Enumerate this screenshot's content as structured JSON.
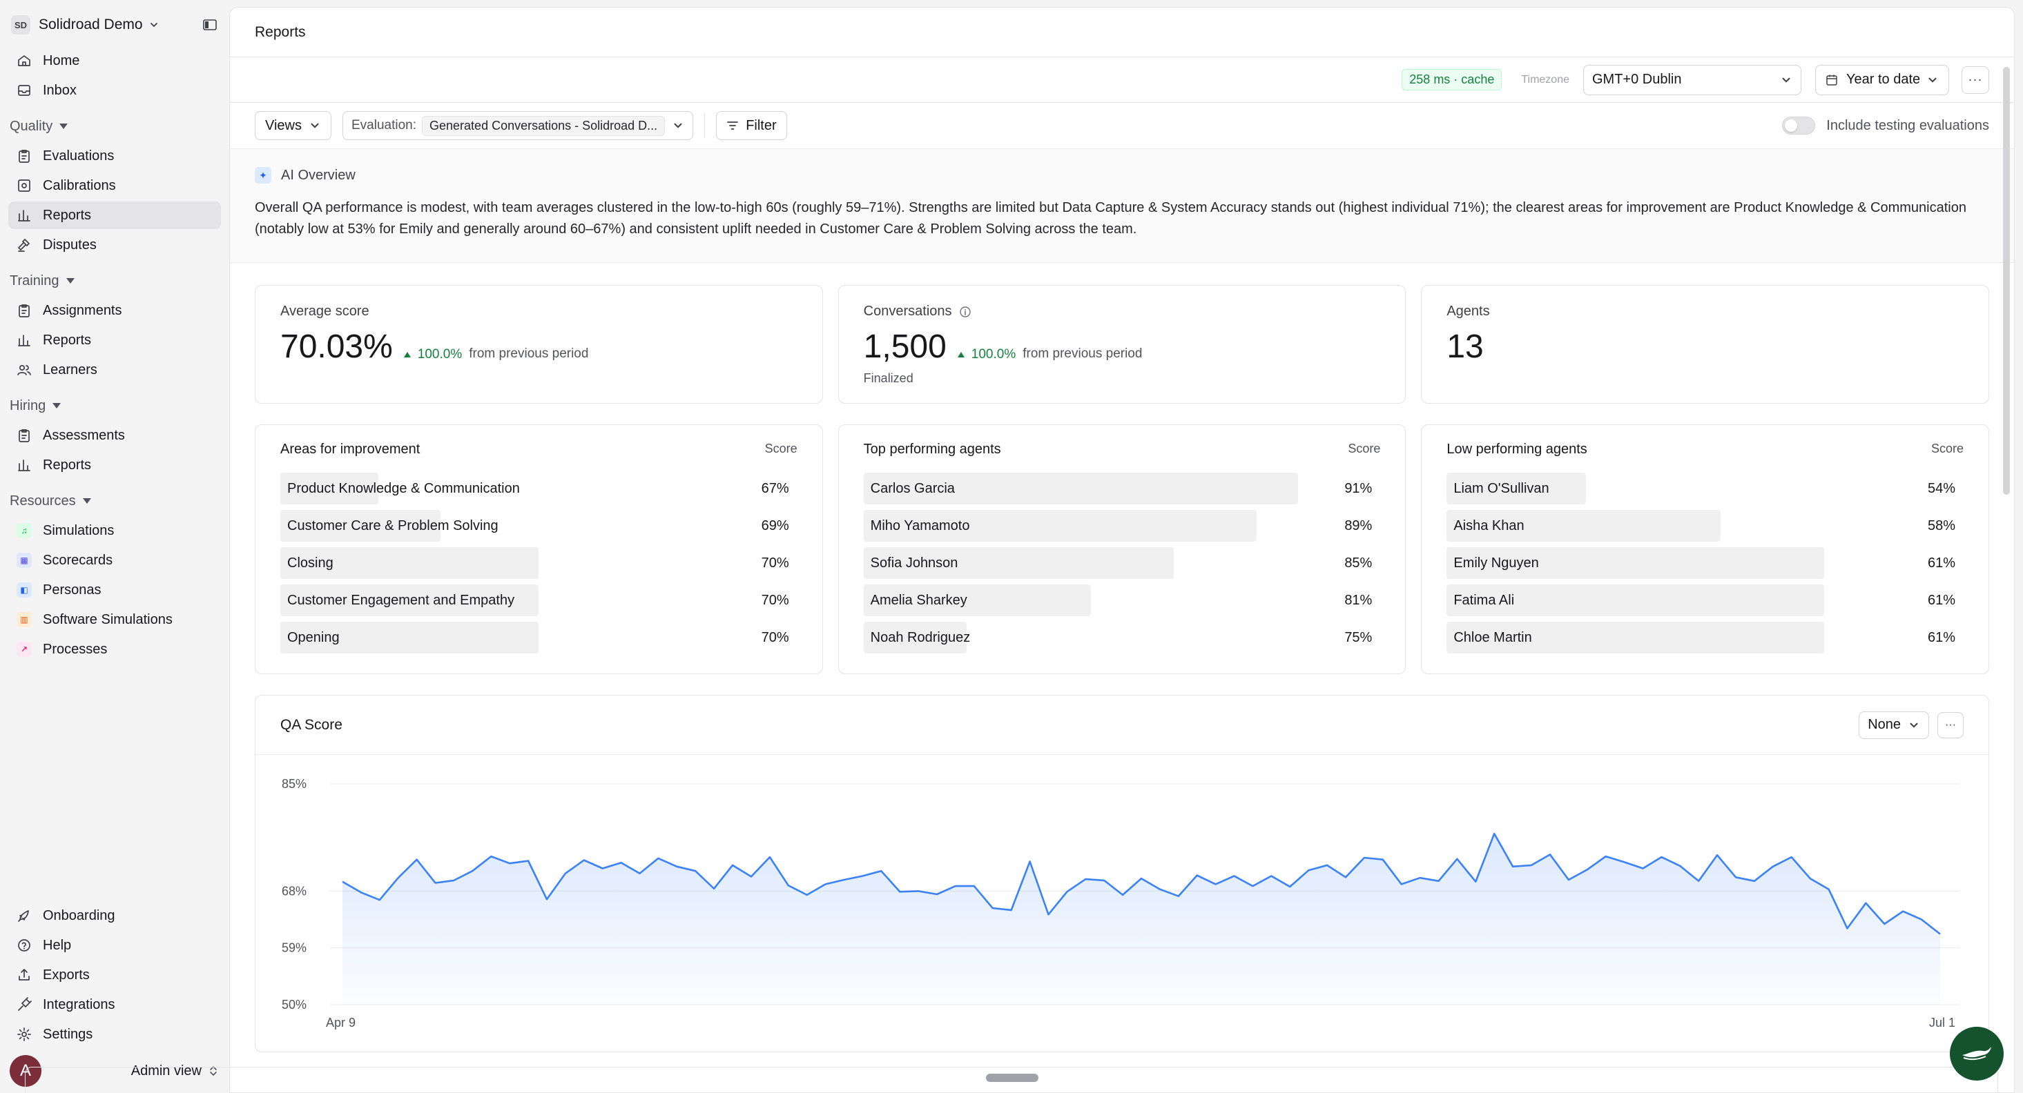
{
  "sidebar": {
    "org_badge": "SD",
    "org_name": "Solidroad Demo",
    "top_items": [
      {
        "label": "Home",
        "icon": "home-icon"
      },
      {
        "label": "Inbox",
        "icon": "inbox-icon"
      }
    ],
    "sections": [
      {
        "title": "Quality",
        "items": [
          {
            "label": "Evaluations",
            "icon": "clipboard-icon"
          },
          {
            "label": "Calibrations",
            "icon": "calibration-icon"
          },
          {
            "label": "Reports",
            "icon": "bar-chart-icon",
            "active": true
          },
          {
            "label": "Disputes",
            "icon": "gavel-icon"
          }
        ]
      },
      {
        "title": "Training",
        "items": [
          {
            "label": "Assignments",
            "icon": "clipboard-icon"
          },
          {
            "label": "Reports",
            "icon": "bar-chart-icon"
          },
          {
            "label": "Learners",
            "icon": "users-icon"
          }
        ]
      },
      {
        "title": "Hiring",
        "items": [
          {
            "label": "Assessments",
            "icon": "clipboard-icon"
          },
          {
            "label": "Reports",
            "icon": "bar-chart-icon"
          }
        ]
      },
      {
        "title": "Resources",
        "items": [
          {
            "label": "Simulations",
            "icon": "headset-icon",
            "color": "#16a34a",
            "bg": "#dcfce7"
          },
          {
            "label": "Scorecards",
            "icon": "scorecard-icon",
            "color": "#4f46e5",
            "bg": "#e0e7ff"
          },
          {
            "label": "Personas",
            "icon": "persona-icon",
            "color": "#2563eb",
            "bg": "#dbeafe"
          },
          {
            "label": "Software Simulations",
            "icon": "software-icon",
            "color": "#ea580c",
            "bg": "#ffedd5"
          },
          {
            "label": "Processes",
            "icon": "process-icon",
            "color": "#db2777",
            "bg": "#fce7f3"
          }
        ]
      }
    ],
    "bottom_items": [
      {
        "label": "Onboarding",
        "icon": "rocket-icon"
      },
      {
        "label": "Help",
        "icon": "help-icon"
      },
      {
        "label": "Exports",
        "icon": "export-icon"
      },
      {
        "label": "Integrations",
        "icon": "plug-icon"
      },
      {
        "label": "Settings",
        "icon": "gear-icon"
      }
    ],
    "user_initial": "A",
    "admin_view": "Admin view"
  },
  "header": {
    "title": "Reports"
  },
  "toolbar": {
    "cache": "258 ms · cache",
    "timezone_label": "Timezone",
    "timezone_value": "GMT+0 Dublin",
    "range": "Year to date",
    "more": "···"
  },
  "filters": {
    "views": "Views",
    "evaluation_label": "Evaluation:",
    "evaluation_value": "Generated Conversations - Solidroad D...",
    "filter": "Filter",
    "toggle_label": "Include testing evaluations",
    "toggle_on": false
  },
  "ai_overview": {
    "title": "AI Overview",
    "text": "Overall QA performance is modest, with team averages clustered in the low-to-high 60s (roughly 59–71%). Strengths are limited but Data Capture & System Accuracy stands out (highest individual 71%); the clearest areas for improvement are Product Knowledge & Communication (notably low at 53% for Emily and generally around 60–67%) and consistent uplift needed in Customer Care & Problem Solving across the team."
  },
  "stats": {
    "avg_score": {
      "label": "Average score",
      "value": "70.03%",
      "delta": "100.0%",
      "delta_suffix": "from previous period"
    },
    "conversations": {
      "label": "Conversations",
      "value": "1,500",
      "delta": "100.0%",
      "delta_suffix": "from previous period",
      "sub": "Finalized"
    },
    "agents": {
      "label": "Agents",
      "value": "13"
    }
  },
  "lists": {
    "improvement": {
      "title": "Areas for improvement",
      "score_header": "Score",
      "rows": [
        {
          "name": "Product Knowledge & Communication",
          "score": "67%",
          "fill": 0.19
        },
        {
          "name": "Customer Care & Problem Solving",
          "score": "69%",
          "fill": 0.31
        },
        {
          "name": "Closing",
          "score": "70%",
          "fill": 0.5
        },
        {
          "name": "Customer Engagement and Empathy",
          "score": "70%",
          "fill": 0.5
        },
        {
          "name": "Opening",
          "score": "70%",
          "fill": 0.5
        }
      ]
    },
    "top": {
      "title": "Top performing agents",
      "score_header": "Score",
      "rows": [
        {
          "name": "Carlos Garcia",
          "score": "91%",
          "fill": 0.84
        },
        {
          "name": "Miho Yamamoto",
          "score": "89%",
          "fill": 0.76
        },
        {
          "name": "Sofia Johnson",
          "score": "85%",
          "fill": 0.6
        },
        {
          "name": "Amelia Sharkey",
          "score": "81%",
          "fill": 0.44
        },
        {
          "name": "Noah Rodriguez",
          "score": "75%",
          "fill": 0.2
        }
      ]
    },
    "low": {
      "title": "Low performing agents",
      "score_header": "Score",
      "rows": [
        {
          "name": "Liam O'Sullivan",
          "score": "54%",
          "fill": 0.27
        },
        {
          "name": "Aisha Khan",
          "score": "58%",
          "fill": 0.53
        },
        {
          "name": "Emily Nguyen",
          "score": "61%",
          "fill": 0.73
        },
        {
          "name": "Fatima Ali",
          "score": "61%",
          "fill": 0.73
        },
        {
          "name": "Chloe Martin",
          "score": "61%",
          "fill": 0.73
        }
      ]
    }
  },
  "qa_chart": {
    "title": "QA Score",
    "group_by": "None",
    "more": "···"
  },
  "chart_data": {
    "type": "area",
    "title": "QA Score",
    "x_start_label": "Apr 9",
    "x_end_label": "Jul 1",
    "yticks": [
      "85%",
      "68%",
      "59%",
      "50%"
    ],
    "ylim": [
      50,
      85
    ],
    "grid": true,
    "color": "#3b82f6",
    "values": [
      69.5,
      67.8,
      66.6,
      70.1,
      73.0,
      69.3,
      69.7,
      71.2,
      73.5,
      72.4,
      72.8,
      66.7,
      70.8,
      72.9,
      71.6,
      72.5,
      70.8,
      73.2,
      71.9,
      71.2,
      68.4,
      72.1,
      70.3,
      73.4,
      68.9,
      67.4,
      69.1,
      69.8,
      70.4,
      71.2,
      67.9,
      68.0,
      67.5,
      68.8,
      68.8,
      65.3,
      65.0,
      72.7,
      64.3,
      67.9,
      69.9,
      69.7,
      67.4,
      70.0,
      68.3,
      67.2,
      70.5,
      69.1,
      70.4,
      68.8,
      70.4,
      68.7,
      71.3,
      72.1,
      70.2,
      73.3,
      73.0,
      69.1,
      70.1,
      69.6,
      73.1,
      69.5,
      77.1,
      71.9,
      72.1,
      73.8,
      69.8,
      71.4,
      73.5,
      72.6,
      71.6,
      73.4,
      72.0,
      69.6,
      73.7,
      70.2,
      69.6,
      71.9,
      73.4,
      70.0,
      68.3,
      62.1,
      66.1,
      62.8,
      64.8,
      63.5,
      61.2
    ]
  }
}
